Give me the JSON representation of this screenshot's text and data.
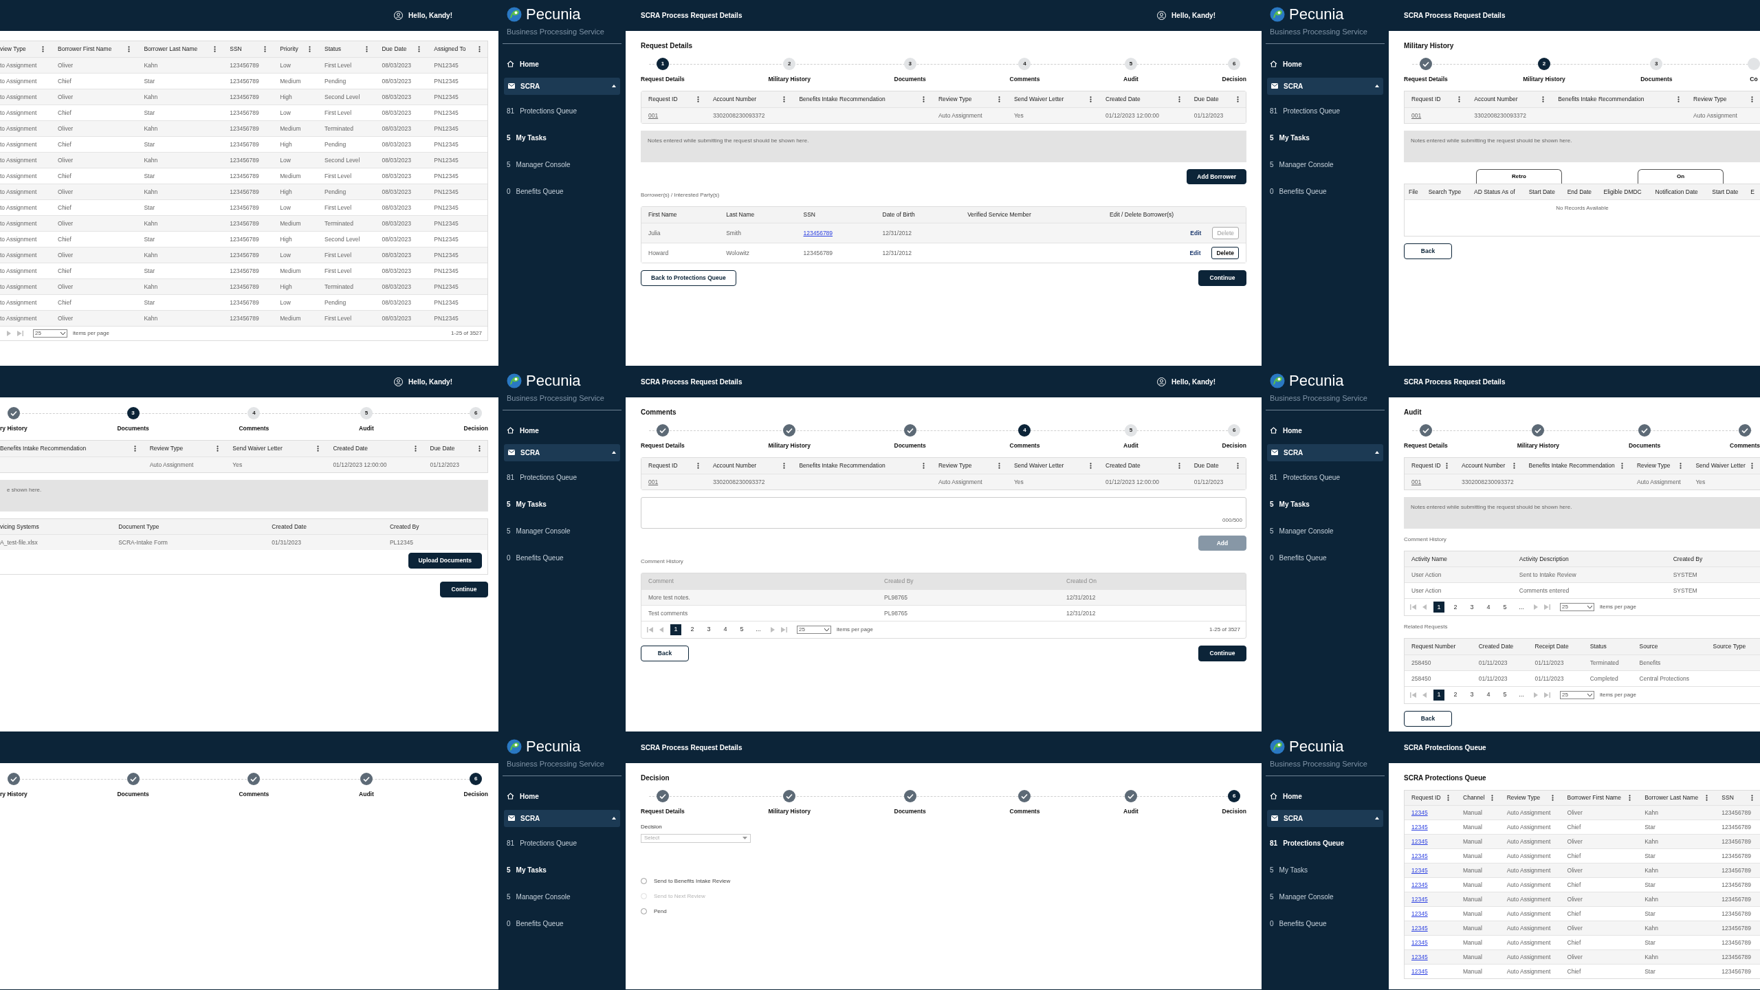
{
  "screens": [
    {
      "kind": "partial",
      "header": {
        "greeting": "Hello, Kandy!"
      },
      "blocks": [
        {
          "kind": "table",
          "column_menus": true,
          "columns": [
            "view Type",
            "Borrower First Name",
            "Borrower Last Name",
            "SSN",
            "Priority",
            "Status",
            "Due Date",
            "Assigned To"
          ],
          "rows": [
            [
              "to Assignment",
              "Oliver",
              "Kahn",
              "123456789",
              "Low",
              "First Level",
              "08/03/2023",
              "PN12345"
            ],
            [
              "to Assignment",
              "Chief",
              "Star",
              "123456789",
              "Medium",
              "Pending",
              "08/03/2023",
              "PN12345"
            ],
            [
              "to Assignment",
              "Oliver",
              "Kahn",
              "123456789",
              "High",
              "Second Level",
              "08/03/2023",
              "PN12345"
            ],
            [
              "to Assignment",
              "Chief",
              "Star",
              "123456789",
              "Low",
              "First Level",
              "08/03/2023",
              "PN12345"
            ],
            [
              "to Assignment",
              "Oliver",
              "Kahn",
              "123456789",
              "Medium",
              "Terminated",
              "08/03/2023",
              "PN12345"
            ],
            [
              "to Assignment",
              "Chief",
              "Star",
              "123456789",
              "High",
              "Pending",
              "08/03/2023",
              "PN12345"
            ],
            [
              "to Assignment",
              "Oliver",
              "Kahn",
              "123456789",
              "Low",
              "Second Level",
              "08/03/2023",
              "PN12345"
            ],
            [
              "to Assignment",
              "Chief",
              "Star",
              "123456789",
              "Medium",
              "First Level",
              "08/03/2023",
              "PN12345"
            ],
            [
              "to Assignment",
              "Oliver",
              "Kahn",
              "123456789",
              "High",
              "Pending",
              "08/03/2023",
              "PN12345"
            ],
            [
              "to Assignment",
              "Chief",
              "Star",
              "123456789",
              "Low",
              "First Level",
              "08/03/2023",
              "PN12345"
            ],
            [
              "to Assignment",
              "Oliver",
              "Kahn",
              "123456789",
              "Medium",
              "Terminated",
              "08/03/2023",
              "PN12345"
            ],
            [
              "to Assignment",
              "Chief",
              "Star",
              "123456789",
              "High",
              "Second Level",
              "08/03/2023",
              "PN12345"
            ],
            [
              "to Assignment",
              "Oliver",
              "Kahn",
              "123456789",
              "Low",
              "First Level",
              "08/03/2023",
              "PN12345"
            ],
            [
              "to Assignment",
              "Chief",
              "Star",
              "123456789",
              "Medium",
              "First Level",
              "08/03/2023",
              "PN12345"
            ],
            [
              "to Assignment",
              "Oliver",
              "Kahn",
              "123456789",
              "High",
              "Terminated",
              "08/03/2023",
              "PN12345"
            ],
            [
              "to Assignment",
              "Chief",
              "Star",
              "123456789",
              "Low",
              "Pending",
              "08/03/2023",
              "PN12345"
            ],
            [
              "to Assignment",
              "Oliver",
              "Kahn",
              "123456789",
              "Medium",
              "First Level",
              "08/03/2023",
              "PN12345"
            ]
          ],
          "pager": {
            "per_page": "25",
            "per_page_label": "items per page",
            "range": "1-25 of 3527"
          }
        }
      ]
    },
    {
      "kind": "full",
      "header": {
        "title": "SCRA Process Request Details",
        "greeting": "Hello, Kandy!"
      },
      "sidebar": {
        "logo": "Pecunia",
        "subtitle": "Business Processing Service",
        "home": "Home",
        "group": {
          "label": "SCRA",
          "expanded": true,
          "items": [
            {
              "count": "81",
              "label": "Protections Queue",
              "selected": false
            },
            {
              "count": "5",
              "label": "My Tasks",
              "selected": true
            },
            {
              "count": "5",
              "label": "Manager Console",
              "selected": false
            },
            {
              "count": "0",
              "label": "Benefits Queue",
              "selected": false
            }
          ]
        }
      },
      "blocks": [
        {
          "kind": "heading",
          "text": "Request Details"
        },
        {
          "kind": "stepper",
          "steps": [
            {
              "label": "Request Details",
              "kind": "current",
              "number": "1"
            },
            {
              "label": "Military History",
              "kind": "todo",
              "number": "2"
            },
            {
              "label": "Documents",
              "kind": "todo",
              "number": "3"
            },
            {
              "label": "Comments",
              "kind": "todo",
              "number": "4"
            },
            {
              "label": "Audit",
              "kind": "todo",
              "number": "5"
            },
            {
              "label": "Decision",
              "kind": "todo",
              "number": "6"
            }
          ]
        },
        {
          "kind": "table",
          "column_menus": true,
          "columns": [
            "Request ID",
            "Account Number",
            "Benefits Intake Recommendation",
            "Review Type",
            "Send Waiver Letter",
            "Created Date",
            "Due Date"
          ],
          "rows": [
            [
              {
                "kind": "id_link",
                "text": "001"
              },
              "3302008230093372",
              null,
              "Auto Assignment",
              "Yes",
              "01/12/2023 12:00:00",
              "01/12/2023"
            ]
          ]
        },
        {
          "kind": "notes",
          "text": "Notes entered while submitting the request should be shown here."
        },
        {
          "kind": "buttons_right",
          "items": [
            {
              "text": "Add Borrower",
              "kind": "primary"
            }
          ]
        },
        {
          "kind": "caption",
          "text": "Borrower(s) / Interested Party(s)"
        },
        {
          "kind": "table",
          "column_menus": false,
          "columns": [
            "First Name",
            "Last Name",
            "SSN",
            "Date of Birth",
            "Verified Service Member",
            "Edit / Delete Borrower(s)"
          ],
          "rows": [
            [
              "Julia",
              "Smith",
              {
                "kind": "link",
                "text": "123456789"
              },
              "12/31/2012",
              null,
              {
                "kind": "actions",
                "items": [
                  {
                    "kind": "edit_link",
                    "text": "Edit"
                  },
                  {
                    "kind": "button",
                    "text": "Delete",
                    "disabled": true
                  }
                ]
              }
            ],
            [
              "Howard",
              "Wolowitz",
              "123456789",
              "12/31/2012",
              null,
              {
                "kind": "actions",
                "items": [
                  {
                    "kind": "edit_link",
                    "text": "Edit"
                  },
                  {
                    "kind": "button",
                    "text": "Delete",
                    "disabled": false
                  }
                ]
              }
            ]
          ]
        },
        {
          "kind": "buttons_split",
          "items": [
            {
              "text": "Back to Protections Queue",
              "kind": "outline"
            },
            {
              "text": "Continue",
              "kind": "primary"
            }
          ]
        }
      ]
    },
    {
      "kind": "partial_right",
      "header": {
        "title": "SCRA Process Request Details"
      },
      "sidebar": {
        "logo": "Pecunia",
        "subtitle": "Business Processing Service",
        "home": "Home",
        "group": {
          "label": "SCRA",
          "expanded": true,
          "items": [
            {
              "count": "81",
              "label": "Protections Queue",
              "selected": false
            },
            {
              "count": "5",
              "label": "My Tasks",
              "selected": true
            },
            {
              "count": "5",
              "label": "Manager Console",
              "selected": false
            },
            {
              "count": "0",
              "label": "Benefits Queue",
              "selected": false
            }
          ]
        }
      },
      "blocks": [
        {
          "kind": "heading",
          "text": "Military History"
        },
        {
          "kind": "stepper",
          "steps": [
            {
              "label": "Request Details",
              "kind": "done"
            },
            {
              "label": "Military History",
              "kind": "current",
              "number": "2"
            },
            {
              "label": "Documents",
              "kind": "todo",
              "number": "3"
            },
            {
              "label": "Co",
              "kind": "todo"
            }
          ]
        },
        {
          "kind": "table",
          "column_menus": true,
          "columns": [
            "Request ID",
            "Account Number",
            "Benefits Intake Recommendation",
            "Review Type"
          ],
          "rows": [
            [
              {
                "kind": "id_link",
                "text": "001"
              },
              "3302008230093372",
              null,
              "Auto Assignment"
            ]
          ]
        },
        {
          "kind": "notes",
          "text": "Notes entered while submitting the request should be shown here."
        },
        {
          "kind": "tabs",
          "items": [
            "Retro",
            "On"
          ]
        },
        {
          "kind": "table",
          "column_menus": false,
          "compact": true,
          "columns": [
            "File",
            "Search Type",
            "AD Status As of",
            "Start Date",
            "End Date",
            "Eligible DMDC",
            "Notification Date",
            "Start Date",
            "E"
          ],
          "empty_text": "No Records Available"
        },
        {
          "kind": "buttons_left",
          "items": [
            {
              "text": "Back",
              "kind": "outline"
            }
          ]
        }
      ]
    },
    {
      "kind": "partial",
      "header": {
        "greeting": "Hello, Kandy!"
      },
      "blocks": [
        {
          "kind": "stepper",
          "steps": [
            {
              "label": "ry History",
              "kind": "done"
            },
            {
              "label": "Documents",
              "kind": "current",
              "number": "3"
            },
            {
              "label": "Comments",
              "kind": "todo",
              "number": "4"
            },
            {
              "label": "Audit",
              "kind": "todo",
              "number": "5"
            },
            {
              "label": "Decision",
              "kind": "todo",
              "number": "6"
            }
          ]
        },
        {
          "kind": "table",
          "column_menus": true,
          "columns": [
            "Benefits Intake Recommendation",
            "Review Type",
            "Send Waiver Letter",
            "Created Date",
            "Due Date"
          ],
          "rows": [
            [
              null,
              "Auto Assignment",
              "Yes",
              "01/12/2023 12:00:00",
              "01/12/2023"
            ]
          ]
        },
        {
          "kind": "notes",
          "text": "e shown here."
        },
        {
          "kind": "table",
          "column_menus": false,
          "columns": [
            "vicing Systems",
            "Document Type",
            "Created Date",
            "Created By"
          ],
          "rows": [
            [
              "A_test-file.xlsx",
              "SCRA-Intake Form",
              "01/31/2023",
              "PL12345"
            ]
          ],
          "action": {
            "text": "Upload Documents",
            "kind": "primary"
          }
        },
        {
          "kind": "buttons_right",
          "items": [
            {
              "text": "Continue",
              "kind": "primary"
            }
          ]
        }
      ]
    },
    {
      "kind": "full",
      "header": {
        "title": "SCRA Process Request Details",
        "greeting": "Hello, Kandy!"
      },
      "sidebar": {
        "logo": "Pecunia",
        "subtitle": "Business Processing Service",
        "home": "Home",
        "group": {
          "label": "SCRA",
          "expanded": true,
          "items": [
            {
              "count": "81",
              "label": "Protections Queue",
              "selected": false
            },
            {
              "count": "5",
              "label": "My Tasks",
              "selected": true
            },
            {
              "count": "5",
              "label": "Manager Console",
              "selected": false
            },
            {
              "count": "0",
              "label": "Benefits Queue",
              "selected": false
            }
          ]
        }
      },
      "blocks": [
        {
          "kind": "heading",
          "text": "Comments"
        },
        {
          "kind": "stepper",
          "steps": [
            {
              "label": "Request Details",
              "kind": "done"
            },
            {
              "label": "Military History",
              "kind": "done"
            },
            {
              "label": "Documents",
              "kind": "done"
            },
            {
              "label": "Comments",
              "kind": "current",
              "number": "4"
            },
            {
              "label": "Audit",
              "kind": "todo",
              "number": "5"
            },
            {
              "label": "Decision",
              "kind": "todo",
              "number": "6"
            }
          ]
        },
        {
          "kind": "table",
          "column_menus": true,
          "columns": [
            "Request ID",
            "Account Number",
            "Benefits Intake Recommendation",
            "Review Type",
            "Send Waiver Letter",
            "Created Date",
            "Due Date"
          ],
          "rows": [
            [
              {
                "kind": "id_link",
                "text": "001"
              },
              "3302008230093372",
              null,
              "Auto Assignment",
              "Yes",
              "01/12/2023 12:00:00",
              "01/12/2023"
            ]
          ]
        },
        {
          "kind": "textarea",
          "counter": "000/500"
        },
        {
          "kind": "buttons_right",
          "items": [
            {
              "text": "Add",
              "kind": "disabled"
            }
          ]
        },
        {
          "kind": "caption",
          "text": "Comment History"
        },
        {
          "kind": "table",
          "column_menus": false,
          "muted_header": true,
          "columns": [
            "Comment",
            "Created By",
            "Created On"
          ],
          "rows": [
            [
              "More test notes.",
              "PL98765",
              "12/31/2012"
            ],
            [
              "Test comments",
              "PL98765",
              "12/31/2012"
            ]
          ],
          "pager": {
            "pages": [
              {
                "label": "1",
                "selected": true
              },
              {
                "label": "2",
                "selected": false
              },
              {
                "label": "3",
                "selected": false
              },
              {
                "label": "4",
                "selected": false
              },
              {
                "label": "5",
                "selected": false
              },
              {
                "label": "...",
                "selected": false
              }
            ],
            "per_page": "25",
            "per_page_label": "items per page",
            "range": "1-25 of 3527"
          }
        },
        {
          "kind": "buttons_split",
          "items": [
            {
              "text": "Back",
              "kind": "outline"
            },
            {
              "text": "Continue",
              "kind": "primary"
            }
          ]
        }
      ]
    },
    {
      "kind": "partial_right",
      "header": {
        "title": "SCRA Process Request Details"
      },
      "sidebar": {
        "logo": "Pecunia",
        "subtitle": "Business Processing Service",
        "home": "Home",
        "group": {
          "label": "SCRA",
          "expanded": true,
          "items": [
            {
              "count": "81",
              "label": "Protections Queue",
              "selected": false
            },
            {
              "count": "5",
              "label": "My Tasks",
              "selected": true
            },
            {
              "count": "5",
              "label": "Manager Console",
              "selected": false
            },
            {
              "count": "0",
              "label": "Benefits Queue",
              "selected": false
            }
          ]
        }
      },
      "blocks": [
        {
          "kind": "heading",
          "text": "Audit"
        },
        {
          "kind": "stepper",
          "steps": [
            {
              "label": "Request Details",
              "kind": "done"
            },
            {
              "label": "Military History",
              "kind": "done"
            },
            {
              "label": "Documents",
              "kind": "done"
            },
            {
              "label": "Comments",
              "kind": "done"
            }
          ]
        },
        {
          "kind": "table",
          "column_menus": true,
          "columns": [
            "Request ID",
            "Account Number",
            "Benefits Intake Recommendation",
            "Review Type",
            "Send Waiver Letter"
          ],
          "rows": [
            [
              {
                "kind": "id_link",
                "text": "001"
              },
              "3302008230093372",
              null,
              "Auto Assignment",
              "Yes"
            ]
          ]
        },
        {
          "kind": "notes",
          "text": "Notes entered while submitting the request should be shown here."
        },
        {
          "kind": "caption",
          "text": "Comment History"
        },
        {
          "kind": "table",
          "column_menus": false,
          "columns": [
            "Activity Name",
            "Activity Description",
            "Created By"
          ],
          "rows": [
            [
              "User Action",
              "Sent to Intake Review",
              "SYSTEM"
            ],
            [
              "User Action",
              "Comments entered",
              "SYSTEM"
            ]
          ],
          "pager": {
            "pages": [
              {
                "label": "1",
                "selected": true
              },
              {
                "label": "2",
                "selected": false
              },
              {
                "label": "3",
                "selected": false
              },
              {
                "label": "4",
                "selected": false
              },
              {
                "label": "5",
                "selected": false
              },
              {
                "label": "...",
                "selected": false
              }
            ],
            "per_page": "25",
            "per_page_label": "items per page"
          }
        },
        {
          "kind": "caption",
          "text": "Related Requests"
        },
        {
          "kind": "table",
          "column_menus": false,
          "columns": [
            "Request Number",
            "Created Date",
            "Receipt Date",
            "Status",
            "Source",
            "Source Type"
          ],
          "rows": [
            [
              "258450",
              "01/11/2023",
              "01/11/2023",
              "Terminated",
              "Benefits",
              null
            ],
            [
              "258450",
              "01/11/2023",
              "01/11/2023",
              "Completed",
              "Central Protections",
              null
            ]
          ],
          "pager": {
            "pages": [
              {
                "label": "1",
                "selected": true
              },
              {
                "label": "2",
                "selected": false
              },
              {
                "label": "3",
                "selected": false
              },
              {
                "label": "4",
                "selected": false
              },
              {
                "label": "5",
                "selected": false
              },
              {
                "label": "...",
                "selected": false
              }
            ],
            "per_page": "25",
            "per_page_label": "items per page"
          }
        },
        {
          "kind": "buttons_left",
          "items": [
            {
              "text": "Back",
              "kind": "outline"
            }
          ]
        }
      ]
    },
    {
      "kind": "partial",
      "blocks": [
        {
          "kind": "stepper",
          "steps": [
            {
              "label": "ry History",
              "kind": "done"
            },
            {
              "label": "Documents",
              "kind": "done"
            },
            {
              "label": "Comments",
              "kind": "done"
            },
            {
              "label": "Audit",
              "kind": "done"
            },
            {
              "label": "Decision",
              "kind": "current",
              "number": "6"
            }
          ]
        }
      ]
    },
    {
      "kind": "full",
      "header": {
        "title": "SCRA Process Request Details"
      },
      "sidebar": {
        "logo": "Pecunia",
        "subtitle": "Business Processing Service",
        "home": "Home",
        "group": {
          "label": "SCRA",
          "expanded": true,
          "items": [
            {
              "count": "81",
              "label": "Protections Queue",
              "selected": false
            },
            {
              "count": "5",
              "label": "My Tasks",
              "selected": true
            },
            {
              "count": "5",
              "label": "Manager Console",
              "selected": false
            },
            {
              "count": "0",
              "label": "Benefits Queue",
              "selected": false
            }
          ]
        }
      },
      "blocks": [
        {
          "kind": "heading",
          "text": "Decision"
        },
        {
          "kind": "stepper",
          "steps": [
            {
              "label": "Request Details",
              "kind": "done"
            },
            {
              "label": "Military History",
              "kind": "done"
            },
            {
              "label": "Documents",
              "kind": "done"
            },
            {
              "label": "Comments",
              "kind": "done"
            },
            {
              "label": "Audit",
              "kind": "done"
            },
            {
              "label": "Decision",
              "kind": "current",
              "number": "6"
            }
          ]
        },
        {
          "kind": "select",
          "label": "Decision",
          "placeholder": "Select"
        },
        {
          "kind": "radios",
          "items": [
            {
              "label": "Send to Benefits Intake Review",
              "selected": false,
              "disabled": false
            },
            {
              "label": "Send to Next Review",
              "selected": false,
              "disabled": true
            },
            {
              "label": "Pend",
              "selected": false,
              "disabled": false
            }
          ]
        }
      ]
    },
    {
      "kind": "partial_right",
      "header": {
        "title": "SCRA Protections Queue"
      },
      "sidebar": {
        "logo": "Pecunia",
        "subtitle": "Business Processing Service",
        "home": "Home",
        "group": {
          "label": "SCRA",
          "expanded": true,
          "items": [
            {
              "count": "81",
              "label": "Protections Queue",
              "selected": true
            },
            {
              "count": "5",
              "label": "My Tasks",
              "selected": false
            },
            {
              "count": "5",
              "label": "Manager Console",
              "selected": false
            },
            {
              "count": "0",
              "label": "Benefits Queue",
              "selected": false
            }
          ]
        }
      },
      "blocks": [
        {
          "kind": "heading",
          "text": "SCRA Protections Queue"
        },
        {
          "kind": "table",
          "column_menus": true,
          "dense": true,
          "columns": [
            "Request ID",
            "Channel",
            "Review Type",
            "Borrower First Name",
            "Borrower Last Name",
            "SSN"
          ],
          "rows": [
            [
              {
                "kind": "link",
                "text": "12345"
              },
              "Manual",
              "Auto Assignment",
              "Oliver",
              "Kahn",
              "123456789"
            ],
            [
              {
                "kind": "link",
                "text": "12345"
              },
              "Manual",
              "Auto Assignment",
              "Chief",
              "Star",
              "123456789"
            ],
            [
              {
                "kind": "link",
                "text": "12345"
              },
              "Manual",
              "Auto Assignment",
              "Oliver",
              "Kahn",
              "123456789"
            ],
            [
              {
                "kind": "link",
                "text": "12345"
              },
              "Manual",
              "Auto Assignment",
              "Chief",
              "Star",
              "123456789"
            ],
            [
              {
                "kind": "link",
                "text": "12345"
              },
              "Manual",
              "Auto Assignment",
              "Oliver",
              "Kahn",
              "123456789"
            ],
            [
              {
                "kind": "link",
                "text": "12345"
              },
              "Manual",
              "Auto Assignment",
              "Chief",
              "Star",
              "123456789"
            ],
            [
              {
                "kind": "link",
                "text": "12345"
              },
              "Manual",
              "Auto Assignment",
              "Oliver",
              "Kahn",
              "123456789"
            ],
            [
              {
                "kind": "link",
                "text": "12345"
              },
              "Manual",
              "Auto Assignment",
              "Chief",
              "Star",
              "123456789"
            ],
            [
              {
                "kind": "link",
                "text": "12345"
              },
              "Manual",
              "Auto Assignment",
              "Oliver",
              "Kahn",
              "123456789"
            ],
            [
              {
                "kind": "link",
                "text": "12345"
              },
              "Manual",
              "Auto Assignment",
              "Chief",
              "Star",
              "123456789"
            ],
            [
              {
                "kind": "link",
                "text": "12345"
              },
              "Manual",
              "Auto Assignment",
              "Oliver",
              "Kahn",
              "123456789"
            ],
            [
              {
                "kind": "link",
                "text": "12345"
              },
              "Manual",
              "Auto Assignment",
              "Chief",
              "Star",
              "123456789"
            ]
          ]
        }
      ]
    }
  ]
}
